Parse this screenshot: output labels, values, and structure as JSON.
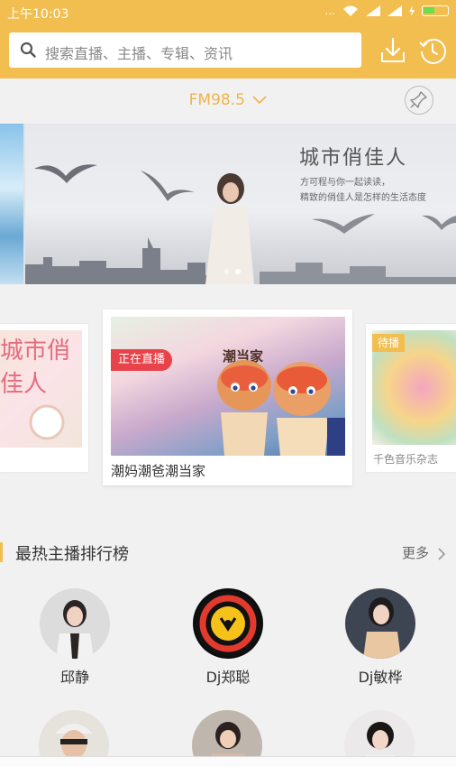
{
  "status": {
    "time": "上午10:03",
    "signal_dots": "..."
  },
  "search": {
    "placeholder": "搜索直播、主播、专辑、资讯"
  },
  "station": {
    "label": "FM98.5"
  },
  "banner": {
    "title": "城市俏佳人",
    "subtitle_line1": "方可程与你一起读读，",
    "subtitle_line2": "精致的俏佳人是怎样的生活态度"
  },
  "carousel": {
    "left_card": {
      "text": "城市俏佳人"
    },
    "center_card": {
      "badge": "正在直播",
      "title": "潮妈潮爸潮当家",
      "logo_text": "潮当家"
    },
    "right_card": {
      "badge": "待播",
      "title": "千色音乐杂志"
    }
  },
  "ranking": {
    "title": "最热主播排行榜",
    "more_label": "更多",
    "anchors": [
      {
        "name": "邱静"
      },
      {
        "name": "Dj郑聪"
      },
      {
        "name": "Dj敏桦"
      }
    ]
  },
  "colors": {
    "accent": "#f2be50",
    "fm": "#f0b449",
    "live": "#e8424a"
  }
}
